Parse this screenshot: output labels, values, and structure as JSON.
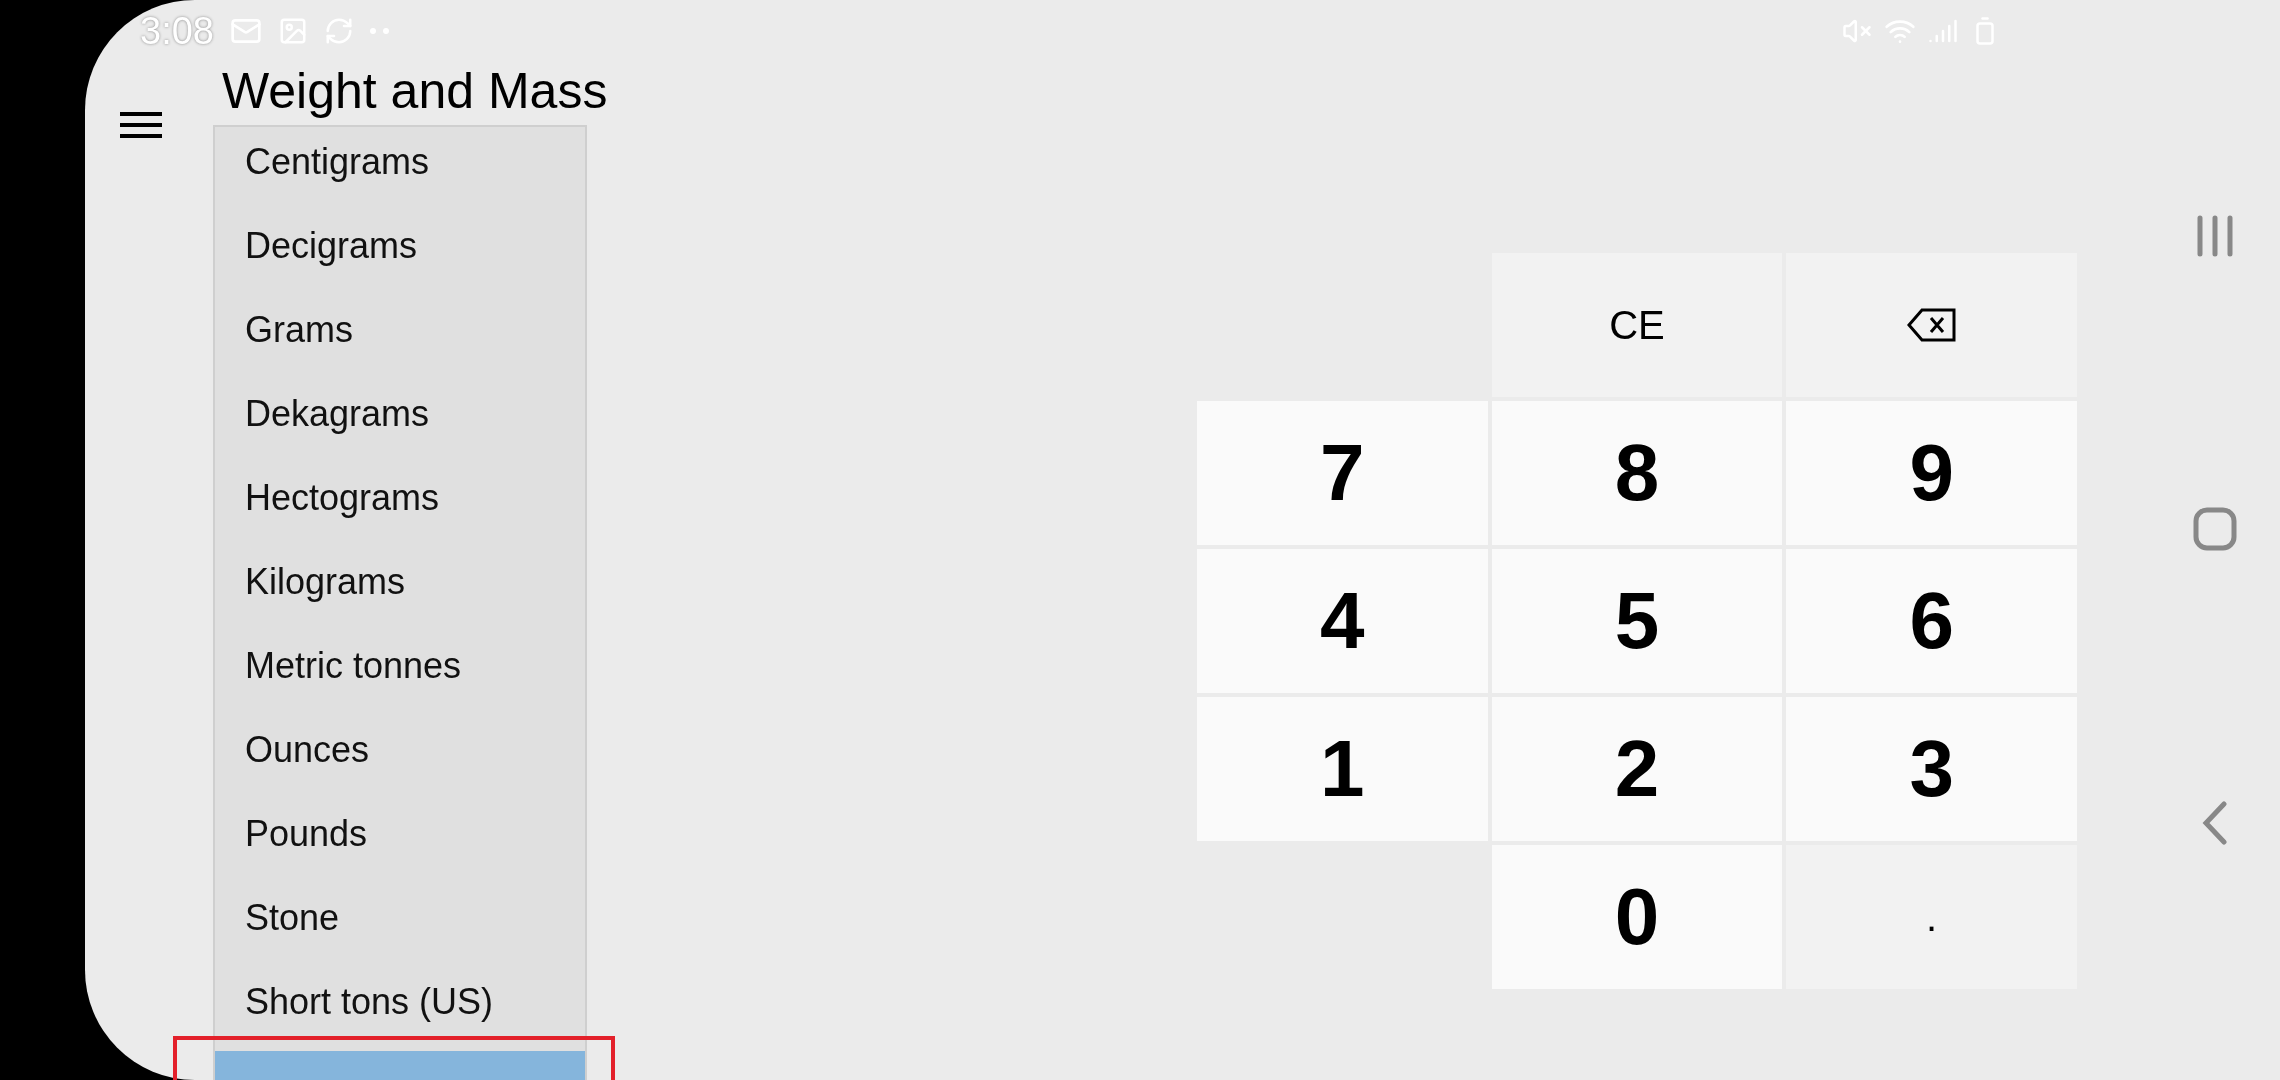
{
  "status_bar": {
    "time": "3:08"
  },
  "app_bar": {
    "title": "Weight and Mass"
  },
  "dropdown": {
    "items": [
      {
        "label": "Centigrams",
        "selected": false
      },
      {
        "label": "Decigrams",
        "selected": false
      },
      {
        "label": "Grams",
        "selected": false
      },
      {
        "label": "Dekagrams",
        "selected": false
      },
      {
        "label": "Hectograms",
        "selected": false
      },
      {
        "label": "Kilograms",
        "selected": false
      },
      {
        "label": "Metric tonnes",
        "selected": false
      },
      {
        "label": "Ounces",
        "selected": false
      },
      {
        "label": "Pounds",
        "selected": false
      },
      {
        "label": "Stone",
        "selected": false
      },
      {
        "label": "Short tons (US)",
        "selected": false
      },
      {
        "selected": true
      }
    ]
  },
  "keypad": {
    "keys": [
      {
        "kind": "blank"
      },
      {
        "kind": "text",
        "label": "CE"
      },
      {
        "kind": "backspace"
      },
      {
        "kind": "digit",
        "label": "7"
      },
      {
        "kind": "digit",
        "label": "8"
      },
      {
        "kind": "digit",
        "label": "9"
      },
      {
        "kind": "digit",
        "label": "4"
      },
      {
        "kind": "digit",
        "label": "5"
      },
      {
        "kind": "digit",
        "label": "6"
      },
      {
        "kind": "digit",
        "label": "1"
      },
      {
        "kind": "digit",
        "label": "2"
      },
      {
        "kind": "digit",
        "label": "3"
      },
      {
        "kind": "blank"
      },
      {
        "kind": "digit",
        "label": "0"
      },
      {
        "kind": "text",
        "label": "."
      }
    ]
  }
}
